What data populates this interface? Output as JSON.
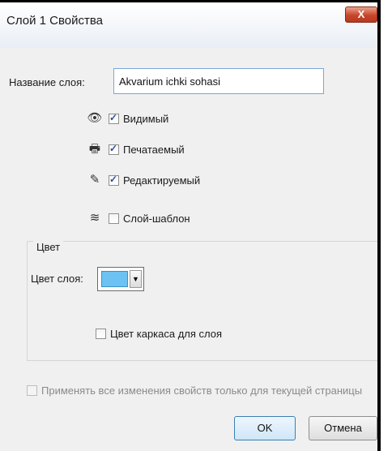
{
  "window": {
    "title": "Слой 1 Свойства",
    "close_symbol": "X"
  },
  "name": {
    "label": "Название слоя:",
    "value": "Akvarium ichki sohasi"
  },
  "options": [
    {
      "key": "visible",
      "label": "Видимый",
      "checked": true,
      "icon": "eye-icon",
      "glyph": "👁"
    },
    {
      "key": "printable",
      "label": "Печатаемый",
      "checked": true,
      "icon": "printer-icon",
      "glyph": "🖶"
    },
    {
      "key": "editable",
      "label": "Редактируемый",
      "checked": true,
      "icon": "pencil-icon",
      "glyph": "✎"
    },
    {
      "key": "template",
      "label": "Слой-шаблон",
      "checked": false,
      "icon": "template-icon",
      "glyph": "≋"
    }
  ],
  "color_group": {
    "title": "Цвет",
    "color_label": "Цвет слоя:",
    "swatch_color": "#6cc2f2",
    "wireframe_label": "Цвет каркаса для слоя",
    "wireframe_checked": false
  },
  "apply_current_page": {
    "label": "Применять все изменения свойств только для текущей страницы",
    "checked": false,
    "enabled": false
  },
  "buttons": {
    "ok": "OK",
    "cancel": "Отмена"
  }
}
